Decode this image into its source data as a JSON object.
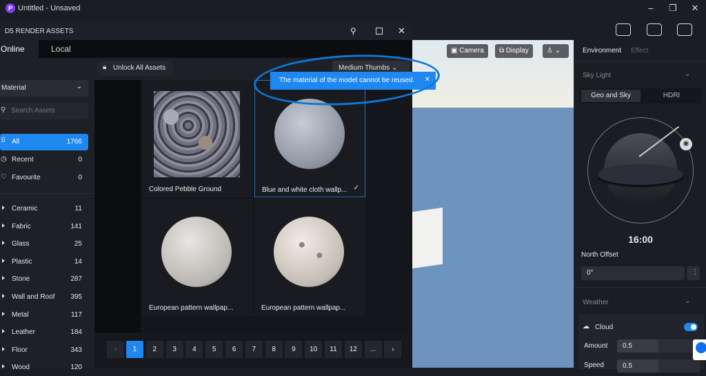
{
  "app": {
    "title": "Untitled - Unsaved",
    "logo": "P"
  },
  "assets": {
    "title": "D5 RENDER ASSETS",
    "tabs": [
      "Online",
      "Local"
    ],
    "unlock_label": "Unlock All Assets",
    "thumb_size": "Medium Thumbs",
    "category_select": "Material",
    "search_placeholder": "Search Assets",
    "nav": [
      {
        "label": "All",
        "count": "1766"
      },
      {
        "label": "Recent",
        "count": "0"
      },
      {
        "label": "Favourite",
        "count": "0"
      }
    ],
    "categories": [
      {
        "label": "Ceramic",
        "count": "11"
      },
      {
        "label": "Fabric",
        "count": "141"
      },
      {
        "label": "Glass",
        "count": "25"
      },
      {
        "label": "Plastic",
        "count": "14"
      },
      {
        "label": "Stone",
        "count": "287"
      },
      {
        "label": "Wall and Roof",
        "count": "395"
      },
      {
        "label": "Metal",
        "count": "117"
      },
      {
        "label": "Leather",
        "count": "184"
      },
      {
        "label": "Floor",
        "count": "343"
      },
      {
        "label": "Wood",
        "count": "120"
      }
    ],
    "items": [
      {
        "name": "Colored Pebble Ground"
      },
      {
        "name": "Blue and white cloth wallp..."
      },
      {
        "name": "European pattern wallpap..."
      },
      {
        "name": "European pattern wallpap..."
      }
    ],
    "pages": [
      "1",
      "2",
      "3",
      "4",
      "5",
      "6",
      "7",
      "8",
      "9",
      "10",
      "11",
      "12",
      "..."
    ],
    "current_page": "1"
  },
  "toast": {
    "message": "The material of the model cannot be reused."
  },
  "viewport": {
    "camera_label": "Camera",
    "display_label": "Display"
  },
  "panel": {
    "tabs": [
      "Environment",
      "Effect"
    ],
    "sky_light": "Sky Light",
    "sky_tabs": [
      "Geo and Sky",
      "HDRI"
    ],
    "time": "16:00",
    "north_offset_label": "North Offset",
    "north_offset_value": "0°",
    "weather": "Weather",
    "cloud_label": "Cloud",
    "cloud_on": true,
    "amount_label": "Amount",
    "amount_value": "0.5",
    "speed_label": "Speed",
    "speed_value": "0.5"
  },
  "colors": {
    "accent": "#1f87f0",
    "background": "#1b1d24"
  }
}
